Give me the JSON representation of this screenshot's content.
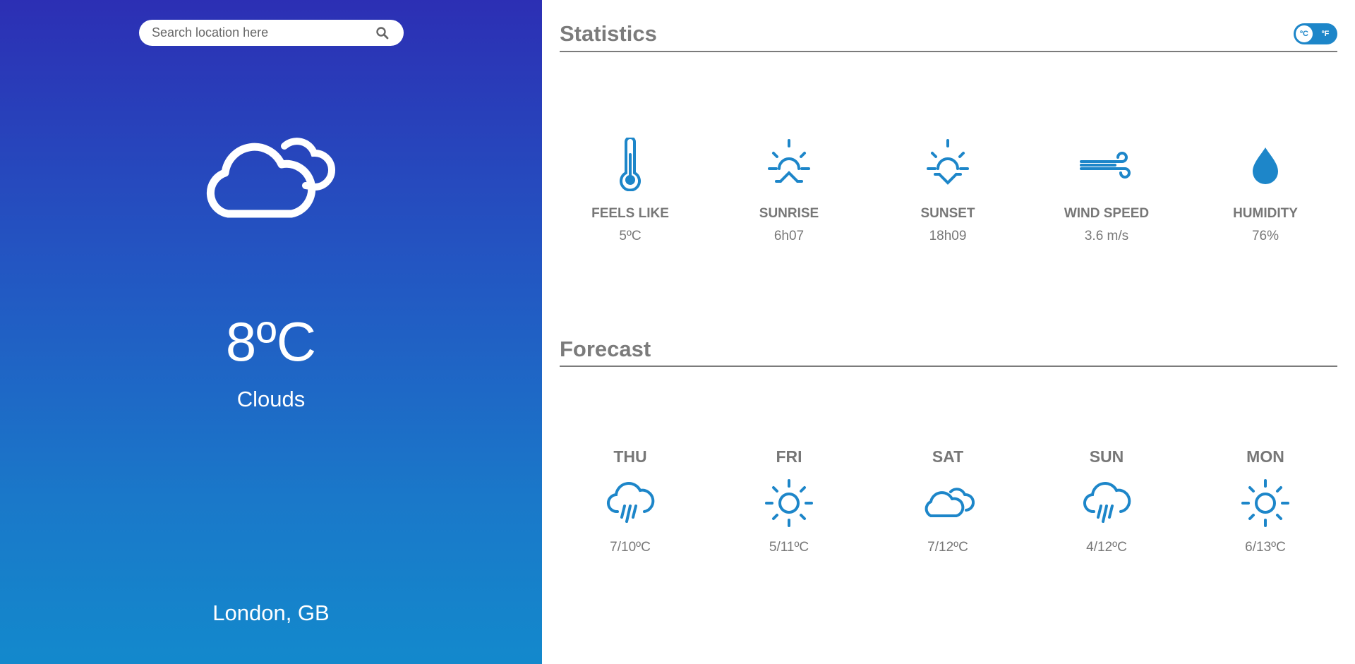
{
  "search": {
    "placeholder": "Search location here",
    "icon": "search-icon"
  },
  "current": {
    "icon": "clouds-icon",
    "temperature": "8ºC",
    "condition": "Clouds",
    "location": "London, GB"
  },
  "statistics": {
    "title": "Statistics",
    "unit_toggle": {
      "celsius": "ºC",
      "fahrenheit": "ºF"
    },
    "items": [
      {
        "icon": "thermometer-icon",
        "label": "FEELS LIKE",
        "value": "5ºC"
      },
      {
        "icon": "sunrise-icon",
        "label": "SUNRISE",
        "value": "6h07"
      },
      {
        "icon": "sunset-icon",
        "label": "SUNSET",
        "value": "18h09"
      },
      {
        "icon": "wind-icon",
        "label": "WIND SPEED",
        "value": "3.6 m/s"
      },
      {
        "icon": "humidity-drop-icon",
        "label": "HUMIDITY",
        "value": "76%"
      }
    ]
  },
  "forecast": {
    "title": "Forecast",
    "days": [
      {
        "day": "THU",
        "icon": "rain-icon",
        "range": "7/10ºC"
      },
      {
        "day": "FRI",
        "icon": "sun-icon",
        "range": "5/11ºC"
      },
      {
        "day": "SAT",
        "icon": "cloud-icon",
        "range": "7/12ºC"
      },
      {
        "day": "SUN",
        "icon": "rain-icon",
        "range": "4/12ºC"
      },
      {
        "day": "MON",
        "icon": "sun-icon",
        "range": "6/13ºC"
      }
    ]
  },
  "colors": {
    "accent": "#1d86c9",
    "text": "#777777",
    "gradient_top": "#2c2fb4",
    "gradient_bottom": "#1389cc"
  }
}
